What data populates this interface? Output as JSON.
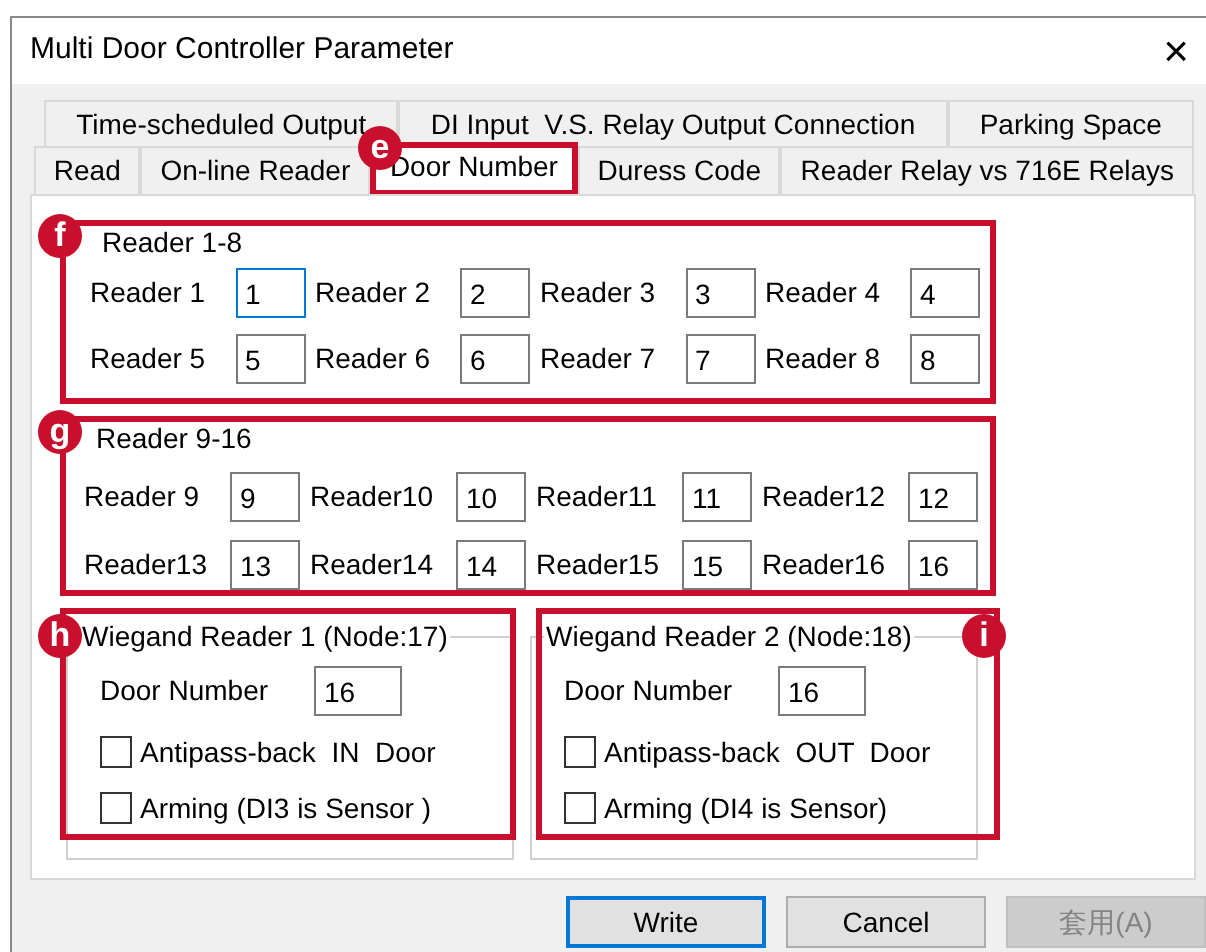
{
  "window": {
    "title": "Multi Door Controller Parameter",
    "close": "×"
  },
  "tab_rows": [
    [
      {
        "label": "Time-scheduled Output",
        "selected": false
      },
      {
        "label": "DI Input  V.S. Relay Output Connection",
        "selected": false
      },
      {
        "label": "Parking Space",
        "selected": false
      }
    ],
    [
      {
        "label": "Read",
        "selected": false
      },
      {
        "label": "On-line Reader",
        "selected": false
      },
      {
        "label": "Door Number",
        "selected": true,
        "callout": "e"
      },
      {
        "label": "Duress Code",
        "selected": false
      },
      {
        "label": "Reader Relay vs 716E Relays",
        "selected": false
      }
    ]
  ],
  "reader_groups": [
    {
      "legend": "Reader 1-8",
      "callout": "f",
      "readers": [
        {
          "label": "Reader 1",
          "value": "1",
          "focused": true
        },
        {
          "label": "Reader 2",
          "value": "2",
          "focused": false
        },
        {
          "label": "Reader 3",
          "value": "3",
          "focused": false
        },
        {
          "label": "Reader 4",
          "value": "4",
          "focused": false
        },
        {
          "label": "Reader 5",
          "value": "5",
          "focused": false
        },
        {
          "label": "Reader 6",
          "value": "6",
          "focused": false
        },
        {
          "label": "Reader 7",
          "value": "7",
          "focused": false
        },
        {
          "label": "Reader 8",
          "value": "8",
          "focused": false
        }
      ]
    },
    {
      "legend": "Reader 9-16",
      "callout": "g",
      "readers": [
        {
          "label": "Reader 9",
          "value": "9",
          "focused": false
        },
        {
          "label": "Reader10",
          "value": "10",
          "focused": false
        },
        {
          "label": "Reader11",
          "value": "11",
          "focused": false
        },
        {
          "label": "Reader12",
          "value": "12",
          "focused": false
        },
        {
          "label": "Reader13",
          "value": "13",
          "focused": false
        },
        {
          "label": "Reader14",
          "value": "14",
          "focused": false
        },
        {
          "label": "Reader15",
          "value": "15",
          "focused": false
        },
        {
          "label": "Reader16",
          "value": "16",
          "focused": false
        }
      ]
    }
  ],
  "wiegand": [
    {
      "legend": "Wiegand Reader 1 (Node:17)",
      "callout": "h",
      "door_label": "Door Number",
      "door_value": "16",
      "options": [
        {
          "label": "Antipass-back  IN  Door",
          "checked": false
        },
        {
          "label": "Arming (DI3 is Sensor )",
          "checked": false
        }
      ]
    },
    {
      "legend": "Wiegand Reader 2 (Node:18)",
      "callout": "i",
      "door_label": "Door Number",
      "door_value": "16",
      "options": [
        {
          "label": "Antipass-back  OUT  Door",
          "checked": false
        },
        {
          "label": "Arming (DI4 is Sensor)",
          "checked": false
        }
      ]
    }
  ],
  "buttons": [
    {
      "label": "Write",
      "default": true,
      "disabled": false
    },
    {
      "label": "Cancel",
      "default": false,
      "disabled": false
    },
    {
      "label": "套用(A)",
      "default": false,
      "disabled": true
    }
  ]
}
